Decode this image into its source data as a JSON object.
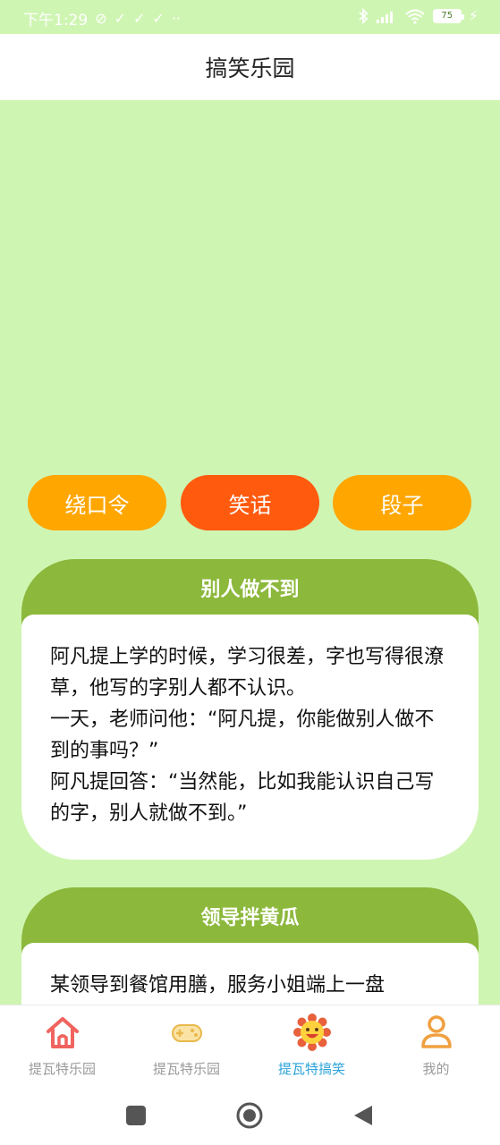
{
  "status_bar": {
    "time": "下午1:29",
    "battery": "75"
  },
  "header": {
    "title": "搞笑乐园"
  },
  "tabs": [
    {
      "label": "绕口令"
    },
    {
      "label": "笑话"
    },
    {
      "label": "段子"
    }
  ],
  "cards": [
    {
      "title": "别人做不到",
      "text": "阿凡提上学的时候，学习很差，字也写得很潦草，他写的字别人都不认识。\n一天，老师问他：“阿凡提，你能做别人做不到的事吗？”\n阿凡提回答：“当然能，比如我能认识自己写的字，别人就做不到。”"
    },
    {
      "title": "领导拌黄瓜",
      "text": "某领导到餐馆用膳，服务小姐端上一盘"
    }
  ],
  "bottom_nav": [
    {
      "label": "提瓦特乐园",
      "icon": "home-icon"
    },
    {
      "label": "提瓦特乐园",
      "icon": "gamepad-icon"
    },
    {
      "label": "提瓦特搞笑",
      "icon": "smiley-flower-icon"
    },
    {
      "label": "我的",
      "icon": "user-icon"
    }
  ],
  "colors": {
    "background": "#cff5b3",
    "tab_active": "#ff5a0e",
    "tab_inactive": "#ffa600",
    "card_header": "#8cb83c",
    "nav_active": "#2ba3d9"
  }
}
